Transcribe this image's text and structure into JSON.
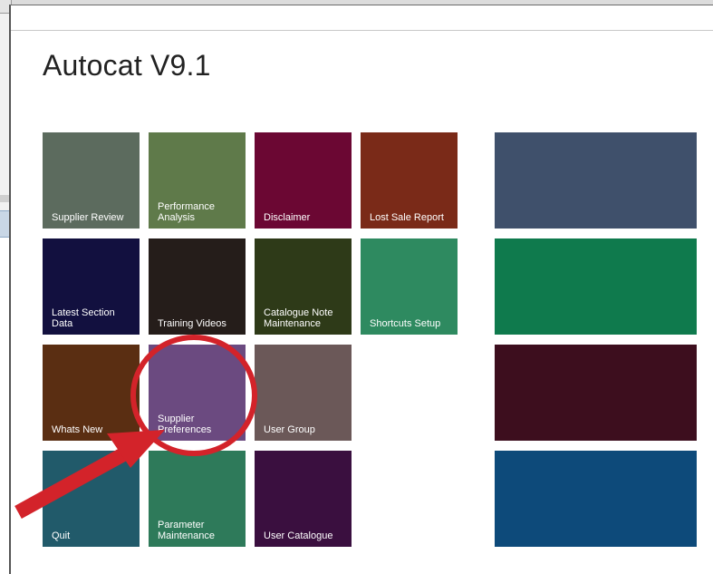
{
  "app": {
    "title": "Autocat V9.1"
  },
  "tiles": [
    {
      "label": "Supplier Review",
      "color": "#5c6b5e"
    },
    {
      "label": "Performance\nAnalysis",
      "color": "#5f7a4a"
    },
    {
      "label": "Disclaimer",
      "color": "#6b0733"
    },
    {
      "label": "Lost Sale Report",
      "color": "#7a2a18"
    },
    {
      "label": "Latest Section\nData",
      "color": "#12103f"
    },
    {
      "label": "Training Videos",
      "color": "#251d1a"
    },
    {
      "label": "Catalogue Note\nMaintenance",
      "color": "#2e3a18"
    },
    {
      "label": "Shortcuts Setup",
      "color": "#2e8a60"
    },
    {
      "label": "Whats New",
      "color": "#5a2e12"
    },
    {
      "label": "Supplier\nPreferences",
      "color": "#6b4a80"
    },
    {
      "label": "User Group",
      "color": "#6b5858"
    },
    {
      "label": "Quit",
      "color": "#215a6a"
    },
    {
      "label": "Parameter\nMaintenance",
      "color": "#2e7a5a"
    },
    {
      "label": "User Catalogue",
      "color": "#3a0f3f"
    }
  ],
  "wide_tiles": [
    {
      "color": "#3f506b"
    },
    {
      "color": "#0f7a4d"
    },
    {
      "color": "#3d0e1e"
    },
    {
      "color": "#0d4a7a"
    }
  ],
  "annotation": {
    "color": "#d3232a"
  }
}
